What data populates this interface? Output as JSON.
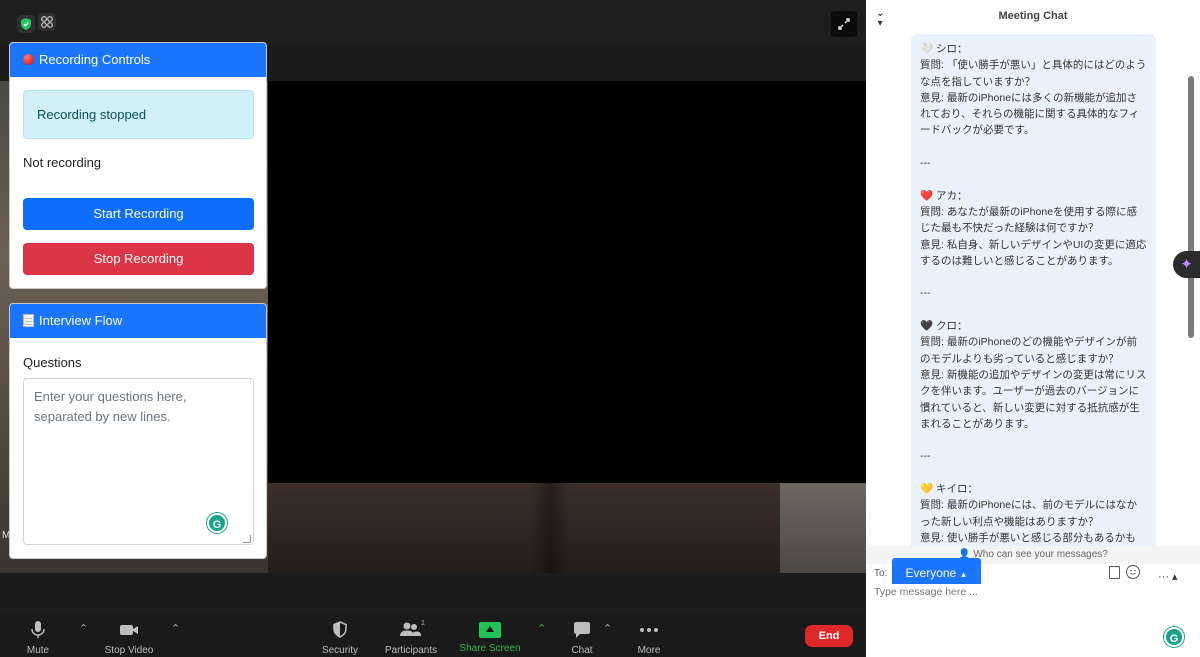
{
  "recording_controls": {
    "title": "Recording Controls",
    "status_box": "Recording stopped",
    "status_text": "Not recording",
    "start_label": "Start Recording",
    "stop_label": "Stop Recording"
  },
  "interview_flow": {
    "title": "Interview Flow",
    "questions_label": "Questions",
    "questions_placeholder": "Enter your questions here, separated by new lines."
  },
  "video": {
    "left_tile_name": "M"
  },
  "toolbar": {
    "mute": "Mute",
    "stop_video": "Stop Video",
    "security": "Security",
    "participants": "Participants",
    "participants_count": "1",
    "share_screen": "Share Screen",
    "chat": "Chat",
    "more": "More",
    "end": "End"
  },
  "chat": {
    "title": "Meeting Chat",
    "message_lines": [
      "🤍 シロ：",
      "質問: 「使い勝手が悪い」と具体的にはどのような点を指していますか？",
      "意見: 最新のiPhoneには多くの新機能が追加されており、それらの機能に関する具体的なフィードバックが必要です。",
      "",
      "---",
      "",
      "❤️ アカ：",
      "質問: あなたが最新のiPhoneを使用する際に感じた最も不快だった経験は何ですか？",
      "意見: 私自身、新しいデザインやUIの変更に適応するのは難しいと感じることがあります。",
      "",
      "---",
      "",
      "🖤 クロ：",
      "質問: 最新のiPhoneのどの機能やデザインが前のモデルよりも劣っていると感じますか？",
      "意見: 新機能の追加やデザインの変更は常にリスクを伴います。ユーザーが過去のバージョンに慣れていると、新しい変更に対する抵抗感が生まれることがあります。",
      "",
      "---",
      "",
      "💛 キイロ：",
      "質問: 最新のiPhoneには、前のモデルにはなかった新しい利点や機能はありますか？",
      "意見: 使い勝手が悪いと感じる部分もあるかも"
    ],
    "who_can_see": "Who can see your messages?",
    "to_label": "To:",
    "recipient": "Everyone",
    "input_placeholder": "Type message here ..."
  },
  "colors": {
    "zoom_blue": "#1a75ff",
    "bootstrap_primary": "#0d6efd",
    "bootstrap_danger": "#dc3545",
    "end_red": "#e02828",
    "share_green": "#20c35a",
    "chat_bubble": "#e8f1fc"
  }
}
